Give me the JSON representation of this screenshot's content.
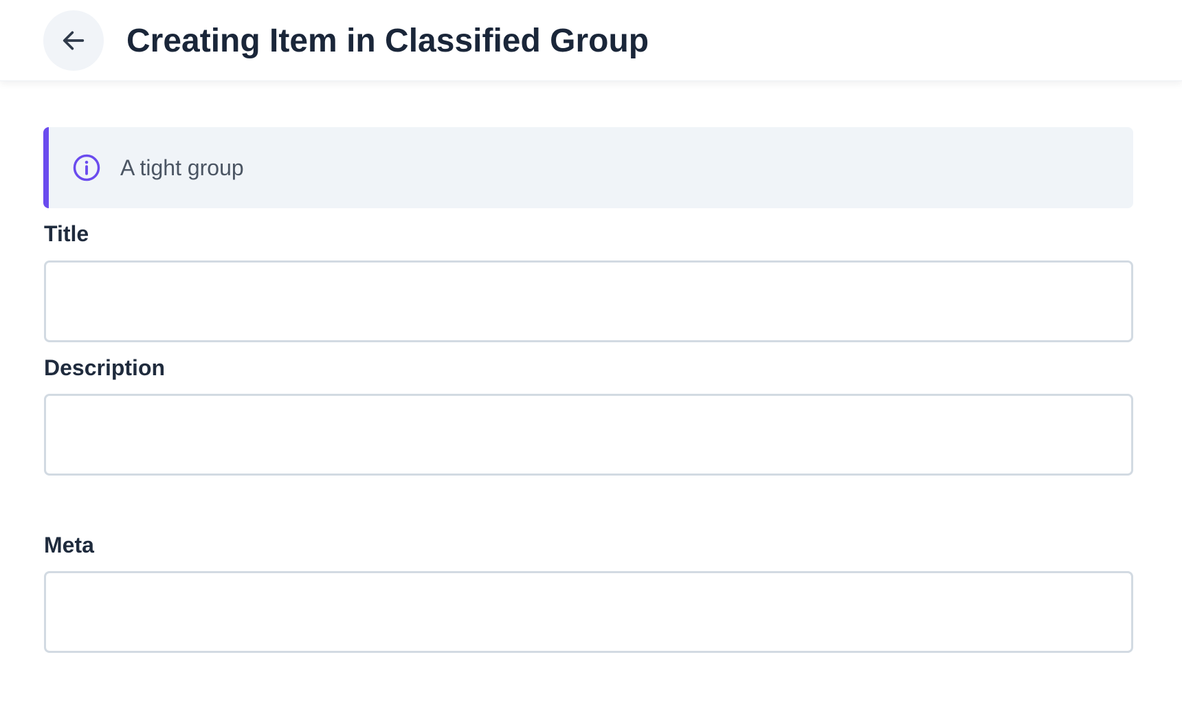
{
  "header": {
    "title": "Creating Item in Classified Group",
    "back_icon": "arrow-left-icon"
  },
  "info_banner": {
    "text": "A tight group",
    "icon": "info-circle-icon",
    "accent_color": "#6a4bee",
    "background_color": "#f0f4f8"
  },
  "form": {
    "fields": [
      {
        "label": "Title",
        "value": ""
      },
      {
        "label": "Description",
        "value": ""
      },
      {
        "label": "Meta",
        "value": ""
      }
    ]
  }
}
